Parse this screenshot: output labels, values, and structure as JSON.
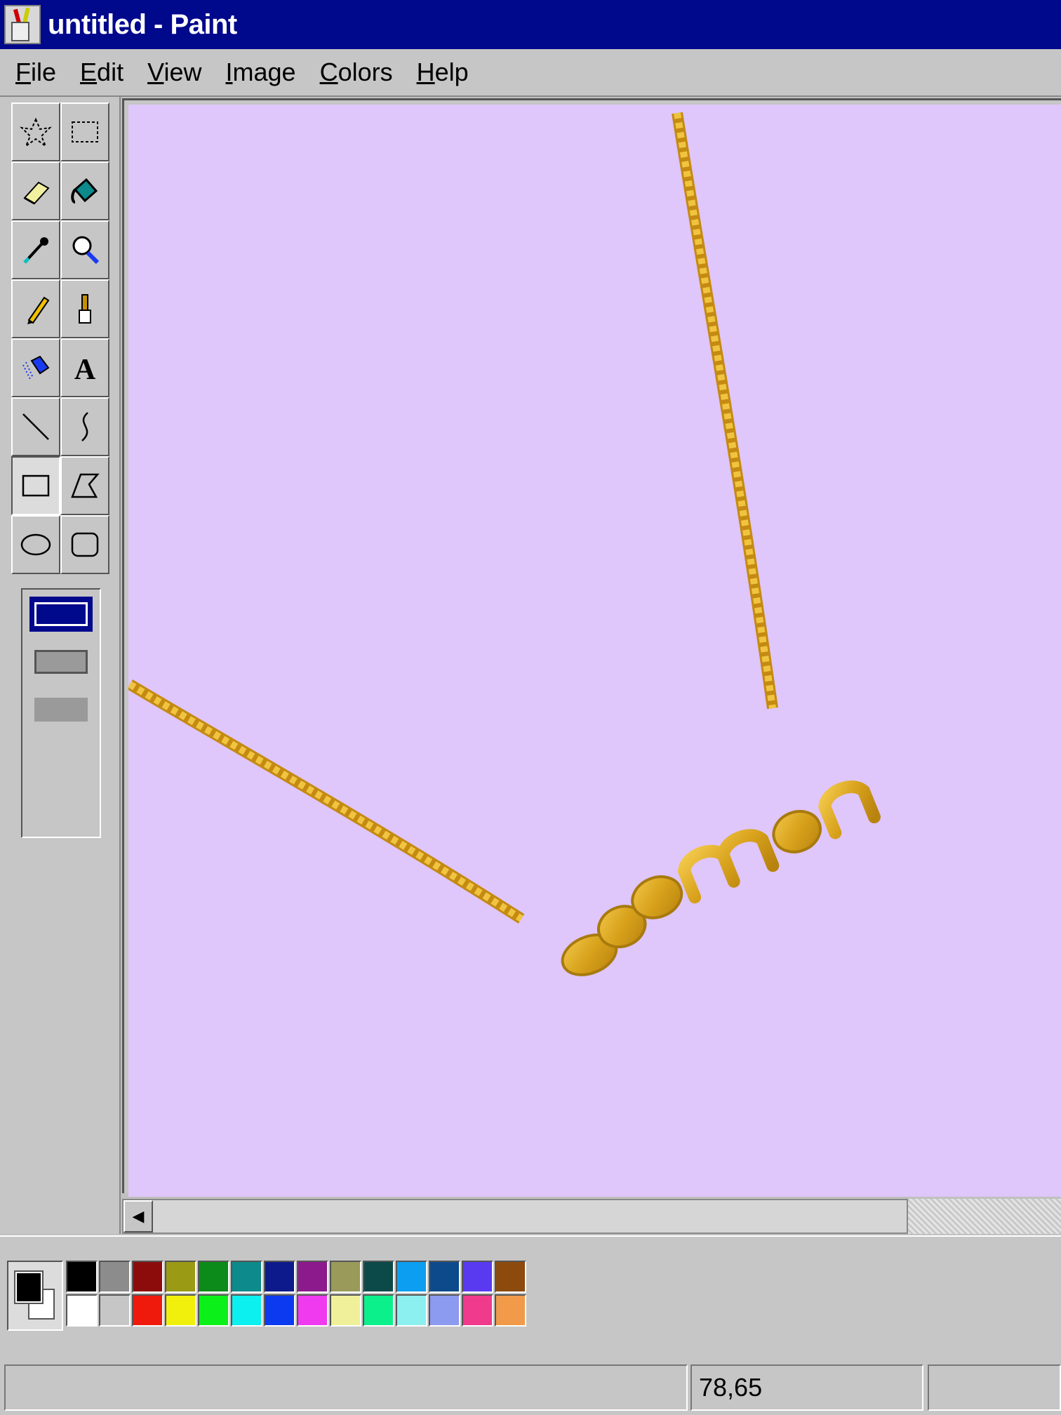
{
  "window": {
    "title": "untitled - Paint"
  },
  "menu": {
    "items": [
      "File",
      "Edit",
      "View",
      "Image",
      "Colors",
      "Help"
    ]
  },
  "toolbox": {
    "tools": [
      {
        "name": "free-form-select-icon",
        "active": false
      },
      {
        "name": "rect-select-icon",
        "active": false
      },
      {
        "name": "eraser-icon",
        "active": false
      },
      {
        "name": "fill-bucket-icon",
        "active": false
      },
      {
        "name": "color-picker-icon",
        "active": false
      },
      {
        "name": "magnifier-icon",
        "active": false
      },
      {
        "name": "pencil-icon",
        "active": false
      },
      {
        "name": "brush-icon",
        "active": false
      },
      {
        "name": "airbrush-icon",
        "active": false
      },
      {
        "name": "text-icon",
        "active": false
      },
      {
        "name": "line-icon",
        "active": false
      },
      {
        "name": "curve-icon",
        "active": false
      },
      {
        "name": "rectangle-icon",
        "active": true
      },
      {
        "name": "polygon-icon",
        "active": false
      },
      {
        "name": "ellipse-icon",
        "active": false
      },
      {
        "name": "rounded-rect-icon",
        "active": false
      }
    ],
    "text_tool_glyph": "A"
  },
  "canvas": {
    "background": "#dfc6fb",
    "content": "gold chain necklace with pendant"
  },
  "palette": {
    "foreground": "#000000",
    "background": "#ffffff",
    "row1": [
      "#000000",
      "#8c8c8c",
      "#8c0c0c",
      "#9a9a14",
      "#0c8a1a",
      "#0c8a8c",
      "#0c1a8c",
      "#8c1a8c",
      "#9a9a5a",
      "#0c4a4a",
      "#0c9ef0",
      "#0c4a8c",
      "#5a3af0",
      "#8c4a0c"
    ],
    "row2": [
      "#ffffff",
      "#c6c6c6",
      "#f01a0c",
      "#f0f00c",
      "#0cf01a",
      "#0cf0f0",
      "#0c3af0",
      "#f03af0",
      "#f0f09a",
      "#0cf08c",
      "#8cf0f0",
      "#8c9af0",
      "#f03a8c",
      "#f09a4a"
    ]
  },
  "status": {
    "coords": "78,65"
  }
}
